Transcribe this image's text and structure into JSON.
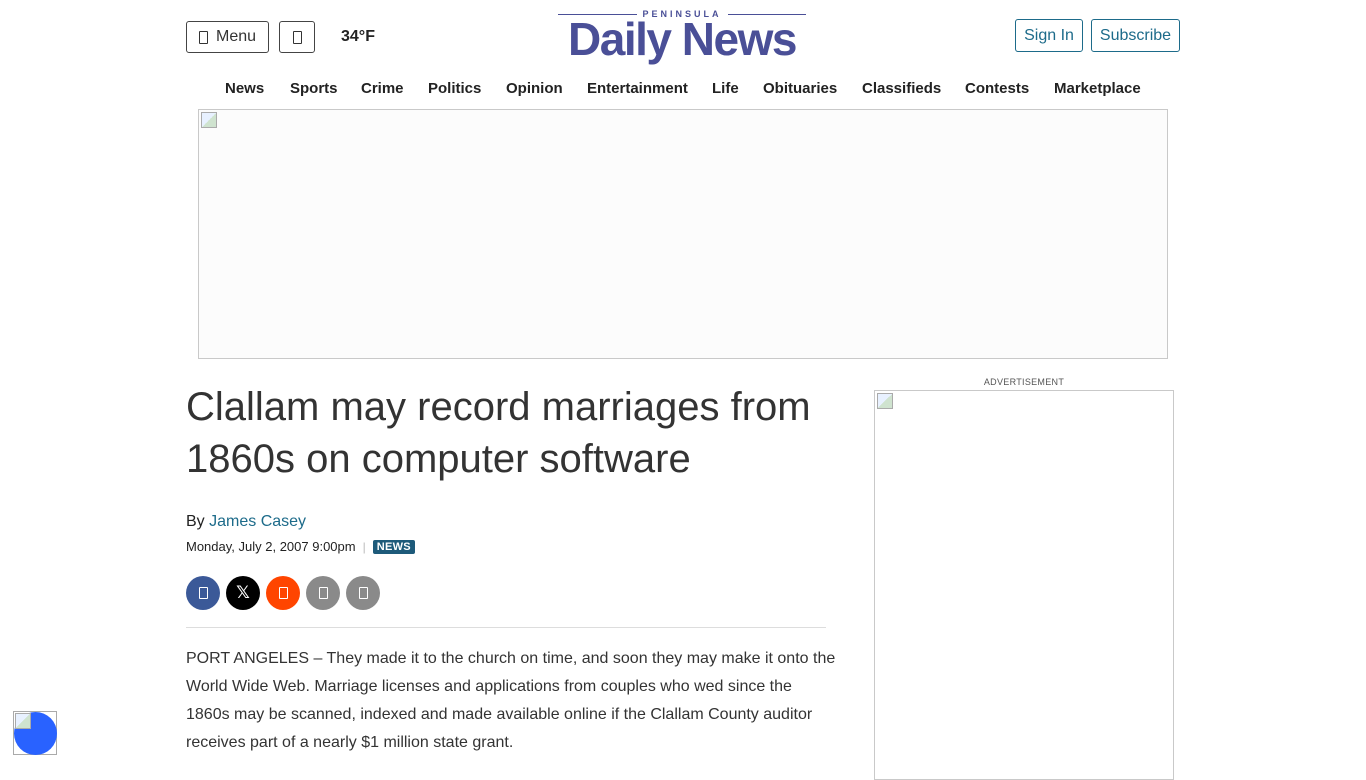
{
  "header": {
    "menu_label": "Menu",
    "weather": "34°F",
    "logo_top": "PENINSULA",
    "logo_main": "Daily News",
    "sign_in": "Sign In",
    "subscribe": "Subscribe"
  },
  "nav": {
    "items": [
      "News",
      "Sports",
      "Crime",
      "Politics",
      "Opinion",
      "Entertainment",
      "Life",
      "Obituaries",
      "Classifieds",
      "Contests",
      "Marketplace"
    ]
  },
  "ad": {
    "label": "ADVERTISEMENT"
  },
  "article": {
    "headline": "Clallam may record marriages from 1860s on computer software",
    "by": "By",
    "author": "James Casey",
    "date": "Monday, July 2, 2007 9:00pm",
    "separator": "|",
    "category": "NEWS",
    "body": "PORT ANGELES – They made it to the church on time, and soon they may make it onto the World Wide Web. Marriage licenses and applications from couples who wed since the 1860s may be scanned, indexed and made available online if the Clallam County auditor receives part of a nearly $1 million state grant."
  },
  "share": {
    "x_glyph": "𝕏",
    "icons": [
      "facebook-icon",
      "x-icon",
      "reddit-icon",
      "email-icon",
      "print-icon"
    ]
  },
  "colors": {
    "brand": "#4a4f97",
    "link": "#1d6b8a",
    "tag_bg": "#1d5a7a",
    "facebook": "#3b5998",
    "reddit": "#ff4500",
    "a11y": "#2962ff"
  }
}
